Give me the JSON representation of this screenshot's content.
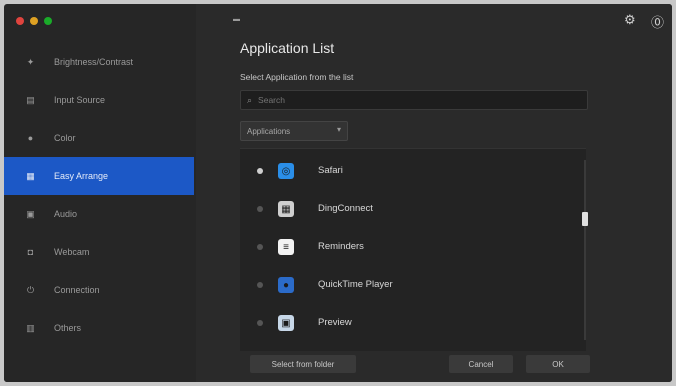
{
  "window": {
    "traffic_lights": [
      "#e0443e",
      "#dea123",
      "#1aab29"
    ]
  },
  "topbar": {
    "settings_icon": "gear-icon",
    "help_icon": "help-icon",
    "handle_glyph": "▬"
  },
  "sidebar": {
    "items": [
      {
        "label": "Brightness/Contrast",
        "icon": "brightness-icon",
        "glyph": "✦"
      },
      {
        "label": "Input Source",
        "icon": "input-source-icon",
        "glyph": "▤"
      },
      {
        "label": "Color",
        "icon": "color-icon",
        "glyph": "●"
      },
      {
        "label": "Easy Arrange",
        "icon": "easy-arrange-icon",
        "glyph": "▦"
      },
      {
        "label": "Audio",
        "icon": "audio-icon",
        "glyph": "▣"
      },
      {
        "label": "Webcam",
        "icon": "webcam-icon",
        "glyph": "◘"
      },
      {
        "label": "Connection",
        "icon": "connection-icon",
        "glyph": "⏻"
      },
      {
        "label": "Others",
        "icon": "others-icon",
        "glyph": "▥"
      }
    ],
    "active_index": 3,
    "accent_color": "#1c58c6"
  },
  "main": {
    "title": "Application List",
    "section_label": "Select Application from the list",
    "search_placeholder": "Search",
    "search_icon_glyph": "⌕",
    "filter_label": "Applications",
    "filter_chevron": "▾",
    "apps": [
      {
        "name": "Safari",
        "icon": "safari-icon",
        "glyph": "◎",
        "color": "#2a8ee8",
        "selected": true
      },
      {
        "name": "DingConnect",
        "icon": "dingconnect-icon",
        "glyph": "▦",
        "color": "#cfcfcf",
        "selected": false
      },
      {
        "name": "Reminders",
        "icon": "reminders-icon",
        "glyph": "≡",
        "color": "#f2f2f2",
        "selected": false
      },
      {
        "name": "QuickTime Player",
        "icon": "quicktime-icon",
        "glyph": "●",
        "color": "#2b6bc9",
        "selected": false
      },
      {
        "name": "Preview",
        "icon": "preview-icon",
        "glyph": "▣",
        "color": "#c7d7e8",
        "selected": false
      }
    ]
  },
  "footer": {
    "select_folder_label": "Select from folder",
    "cancel_label": "Cancel",
    "ok_label": "OK"
  }
}
